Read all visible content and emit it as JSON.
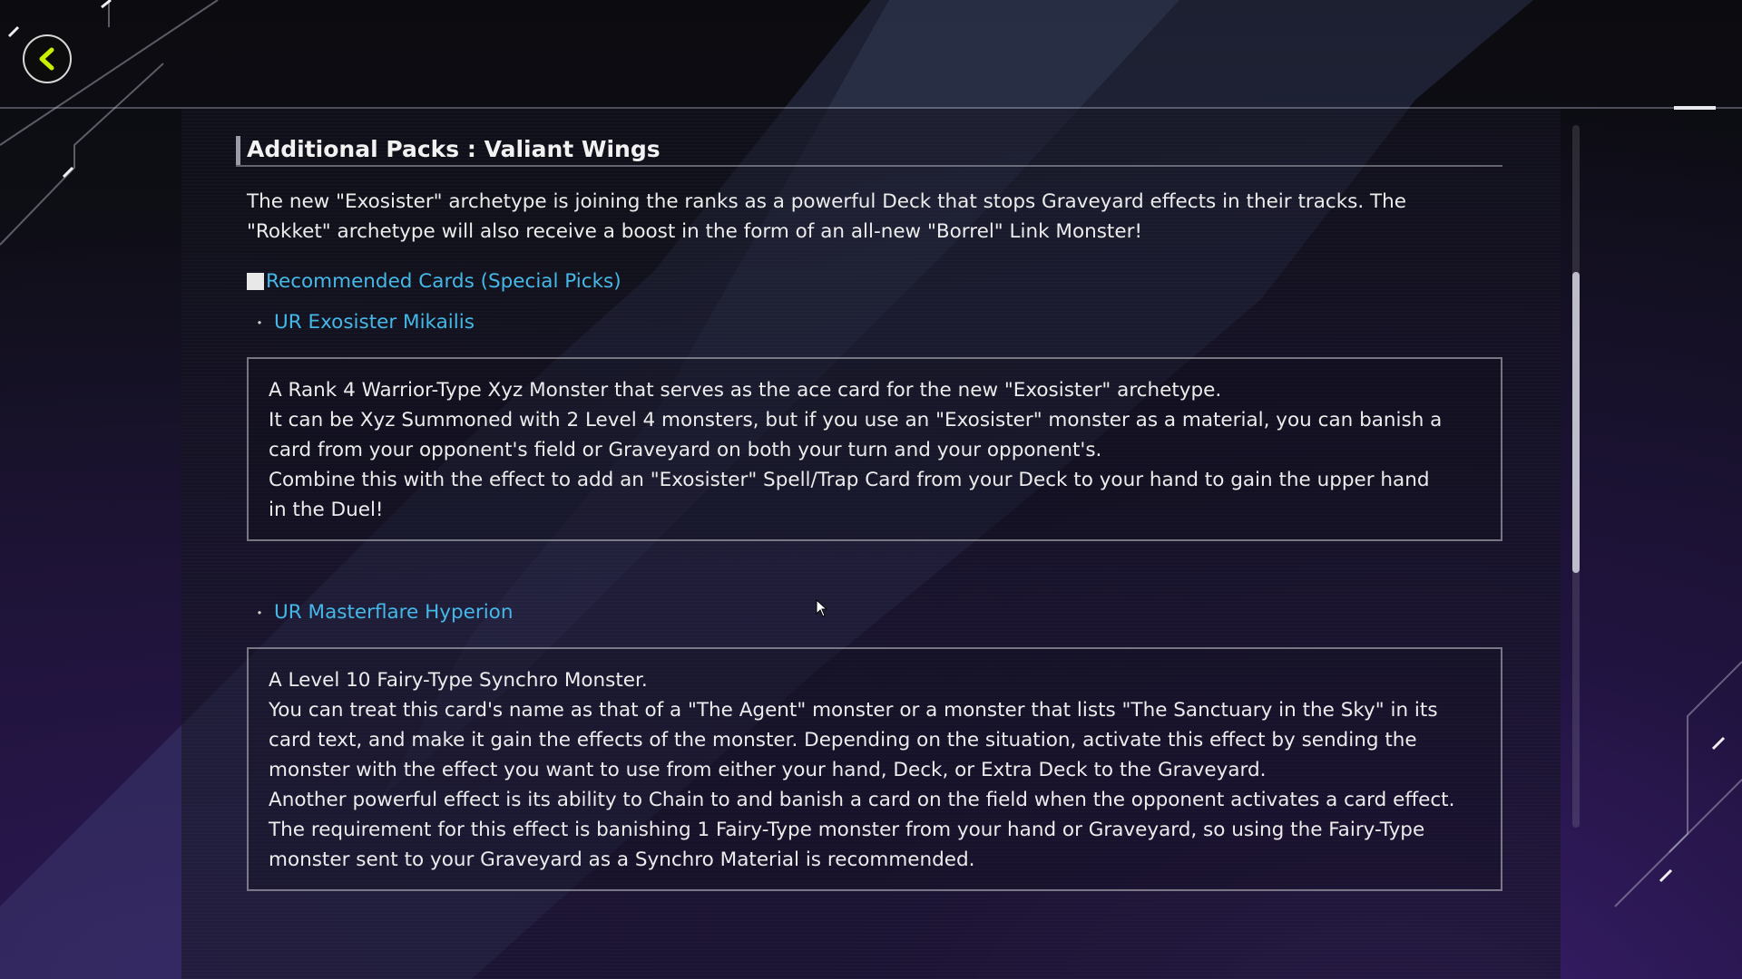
{
  "header": {
    "back_label": "Back"
  },
  "article": {
    "title": "Additional Packs : Valiant Wings",
    "intro_lines": [
      "The new \"Exosister\" archetype is joining the ranks as a powerful Deck that stops Graveyard effects in their tracks. The",
      "\"Rokket\" archetype will also receive a boost in the form of an all-new \"Borrel\" Link Monster!"
    ],
    "section_heading": "Recommended Cards (Special Picks)",
    "cards": [
      {
        "name": "UR Exosister Mikailis",
        "description_lines": [
          "A Rank 4 Warrior-Type Xyz Monster that serves as the ace card for the new \"Exosister\" archetype.",
          "It can be Xyz Summoned with 2 Level 4 monsters, but if you use an \"Exosister\" monster as a material, you can banish a",
          "card from your opponent's field or Graveyard on both your turn and your opponent's.",
          "Combine this with the effect to add an \"Exosister\" Spell/Trap Card from your Deck to your hand to gain the upper hand",
          "in the Duel!"
        ]
      },
      {
        "name": "UR Masterflare Hyperion",
        "description_lines": [
          "A Level 10 Fairy-Type Synchro Monster.",
          "You can treat this card's name as that of a \"The Agent\" monster or a monster that lists \"The Sanctuary in the Sky\" in its",
          "card text, and make it gain the effects of the monster. Depending on the situation, activate this effect by sending the",
          "monster with the effect you want to use from either your hand, Deck, or Extra Deck to the Graveyard.",
          "Another powerful effect is its ability to Chain to and banish a card on the field when the opponent activates a card effect.",
          "The requirement for this effect is banishing 1 Fairy-Type monster from your hand or Graveyard, so using the Fairy-Type",
          "monster sent to your Graveyard as a Synchro Material is recommended."
        ]
      }
    ]
  },
  "colors": {
    "link": "#45b8e8",
    "back_arrow": "#c8f000",
    "text": "#ececec"
  },
  "icons": {
    "back": "chevron-left-icon",
    "cursor": "mouse-cursor-icon"
  }
}
